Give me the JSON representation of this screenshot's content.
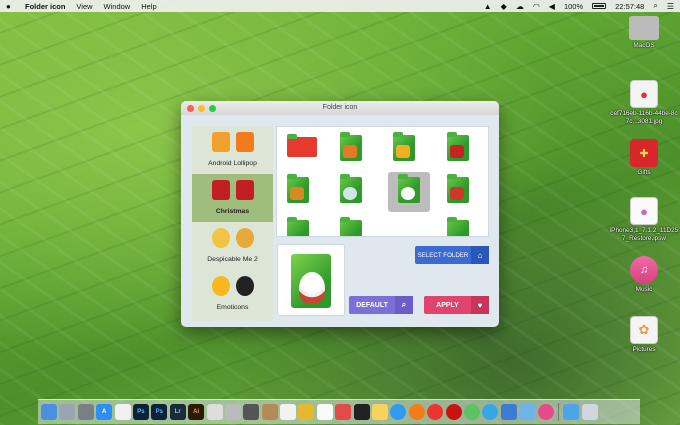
{
  "menubar": {
    "app_name": "Folder icon",
    "menus": [
      "View",
      "Window",
      "Help"
    ],
    "battery": "100%",
    "time": "22:57:48"
  },
  "desktop_icons": [
    {
      "label": "MacOS",
      "icon": "hard-drive-icon"
    },
    {
      "label": "cef716eb-116b-44be-8c7c...3081.jpg",
      "icon": "image-file-icon"
    },
    {
      "label": "Gifts",
      "icon": "gift-icon"
    },
    {
      "label": "iPhone3,1_7.1.2_11D257_Restore.ipsw",
      "icon": "ipsw-file-icon"
    },
    {
      "label": "Music",
      "icon": "music-icon"
    },
    {
      "label": "Pictures",
      "icon": "photos-icon"
    }
  ],
  "window": {
    "title": "Folder icon",
    "categories": [
      {
        "label": "Android Lollipop",
        "active": false
      },
      {
        "label": "Christmas",
        "active": true
      },
      {
        "label": "Despicable Me 2",
        "active": false
      },
      {
        "label": "Emoticons",
        "active": false
      }
    ],
    "buttons": {
      "select_folder": "SELECT FOLDER",
      "default": "DEFAULT",
      "apply": "APPLY"
    }
  },
  "colors": {
    "active_category": "#9fbd7c",
    "select_button": "#3b6bd0",
    "default_button": "#7d6fd8",
    "apply_button": "#e0436b"
  },
  "dock_items": [
    "finder-icon",
    "launchpad-icon",
    "system-preferences-icon",
    "app-store-icon",
    "photos-icon",
    "photoshop-icon",
    "photoshop-icon",
    "lightroom-icon",
    "illustrator-icon",
    "sketchup-icon",
    "alfred-icon",
    "stickies-icon",
    "notes-icon",
    "finder-folder-icon",
    "keynote-icon",
    "text-icon",
    "terminal-icon",
    "video-icon",
    "calendar-icon",
    "safari-icon",
    "firefox-icon",
    "chrome-icon",
    "opera-icon",
    "messages-icon",
    "skype-icon",
    "xcode-icon",
    "preview-icon",
    "itunes-icon",
    "folder-icon",
    "trash-icon"
  ]
}
